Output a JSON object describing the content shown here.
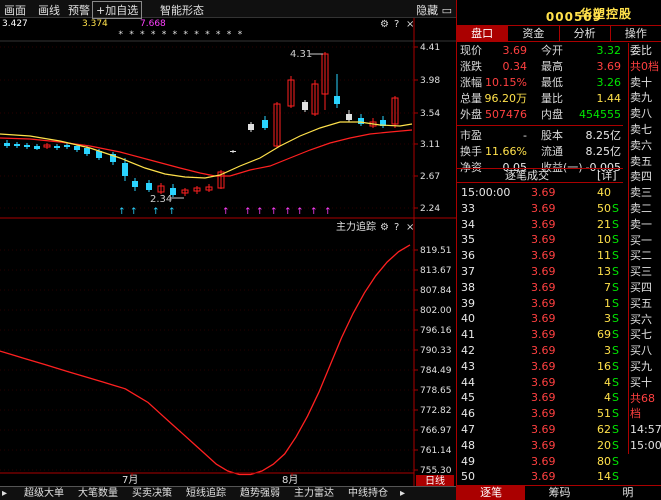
{
  "toolbar": {
    "items": [
      "画面",
      "画线",
      "预警",
      "+加自选",
      "智能形态"
    ],
    "hide_label": "隐藏"
  },
  "kline": {
    "legend": [
      {
        "text": "3.427",
        "color": "#ffffff"
      },
      {
        "text": "3.374",
        "color": "#ffe14b"
      },
      {
        "text": "7.668",
        "color": "#ff40ff"
      }
    ],
    "y_ticks": [
      "4.41",
      "3.98",
      "3.54",
      "3.11",
      "2.67",
      "2.24"
    ],
    "tag_high": "4.31",
    "tag_low": "2.34",
    "stars": "* *     * * *    * *   * *     *   * *"
  },
  "indicator": {
    "title": "主力追踪",
    "y_ticks": [
      "819.51",
      "813.67",
      "807.84",
      "802.00",
      "796.16",
      "790.33",
      "784.49",
      "778.65",
      "772.82",
      "766.97",
      "761.14",
      "755.30"
    ],
    "x_ticks": [
      "7月",
      "8月"
    ],
    "series": [
      {
        "name": "主力追踪",
        "values": [
          790,
          789,
          788,
          787,
          786,
          785,
          784,
          783,
          782,
          781,
          780,
          779,
          777,
          775,
          772,
          769,
          766,
          763,
          760,
          757,
          755,
          754,
          754,
          755,
          757,
          760,
          765,
          771,
          778,
          786,
          794,
          801,
          807,
          812,
          816,
          819,
          821
        ]
      }
    ]
  },
  "bottom_tabs": [
    "超级大单",
    "大笔数量",
    "买卖决策",
    "短线追踪",
    "趋势强弱",
    "主力雷达",
    "中线持仓"
  ],
  "stock": {
    "code": "000509",
    "name": "华塑控股"
  },
  "right_tabs": [
    "盘口",
    "资金",
    "分析",
    "操作"
  ],
  "quote": [
    {
      "l1": "现价",
      "v1": "3.69",
      "c1": "red",
      "l2": "今开",
      "v2": "3.32",
      "c2": "green"
    },
    {
      "l1": "涨跌",
      "v1": "0.34",
      "c1": "red",
      "l2": "最高",
      "v2": "3.69",
      "c2": "red"
    },
    {
      "l1": "涨幅",
      "v1": "10.15%",
      "c1": "red",
      "l2": "最低",
      "v2": "3.26",
      "c2": "green"
    },
    {
      "l1": "总量",
      "v1": "96.20万",
      "c1": "yellow",
      "l2": "量比",
      "v2": "1.44",
      "c2": "yellow"
    },
    {
      "l1": "外盘",
      "v1": "507476",
      "c1": "red",
      "l2": "内盘",
      "v2": "454555",
      "c2": "green"
    }
  ],
  "quote2": [
    {
      "l1": "市盈",
      "v1": "-",
      "c1": "white",
      "l2": "股本",
      "v2": "8.25亿",
      "c2": "white"
    },
    {
      "l1": "换手",
      "v1": "11.66%",
      "c1": "yellow",
      "l2": "流通",
      "v2": "8.25亿",
      "c2": "white"
    },
    {
      "l1": "净资",
      "v1": "0.05",
      "c1": "white",
      "l2": "收益(一)",
      "v2": "-0.005",
      "c2": "white"
    }
  ],
  "trades_title": "逐笔成交",
  "trades_btn": "[详]",
  "trades": [
    {
      "t": "15:00:00",
      "p": "3.69",
      "n": "40",
      "s": ""
    },
    {
      "t": "33",
      "p": "3.69",
      "n": "50",
      "s": "S"
    },
    {
      "t": "34",
      "p": "3.69",
      "n": "21",
      "s": "S"
    },
    {
      "t": "35",
      "p": "3.69",
      "n": "10",
      "s": "S"
    },
    {
      "t": "36",
      "p": "3.69",
      "n": "11",
      "s": "S"
    },
    {
      "t": "37",
      "p": "3.69",
      "n": "13",
      "s": "S"
    },
    {
      "t": "38",
      "p": "3.69",
      "n": "7",
      "s": "S"
    },
    {
      "t": "39",
      "p": "3.69",
      "n": "1",
      "s": "S"
    },
    {
      "t": "40",
      "p": "3.69",
      "n": "3",
      "s": "S"
    },
    {
      "t": "41",
      "p": "3.69",
      "n": "69",
      "s": "S"
    },
    {
      "t": "42",
      "p": "3.69",
      "n": "3",
      "s": "S"
    },
    {
      "t": "43",
      "p": "3.69",
      "n": "16",
      "s": "S"
    },
    {
      "t": "44",
      "p": "3.69",
      "n": "4",
      "s": "S"
    },
    {
      "t": "45",
      "p": "3.69",
      "n": "4",
      "s": "S"
    },
    {
      "t": "46",
      "p": "3.69",
      "n": "51",
      "s": "S"
    },
    {
      "t": "47",
      "p": "3.69",
      "n": "62",
      "s": "S"
    },
    {
      "t": "48",
      "p": "3.69",
      "n": "20",
      "s": "S"
    },
    {
      "t": "49",
      "p": "3.69",
      "n": "80",
      "s": "S"
    },
    {
      "t": "50",
      "p": "3.69",
      "n": "14",
      "s": "S"
    }
  ],
  "orderbook": [
    "委比",
    "共0档",
    "卖十",
    "卖九",
    "卖八",
    "卖七",
    "卖六",
    "卖五",
    "卖四",
    "卖三",
    "卖二",
    "卖一",
    "买一",
    "买二",
    "买三",
    "买四",
    "买五",
    "买六",
    "买七",
    "买八",
    "买九",
    "买十",
    "共68档",
    "",
    "14:57",
    "15:00"
  ],
  "right_bottom": [
    "逐笔",
    "筹码",
    "明"
  ]
}
